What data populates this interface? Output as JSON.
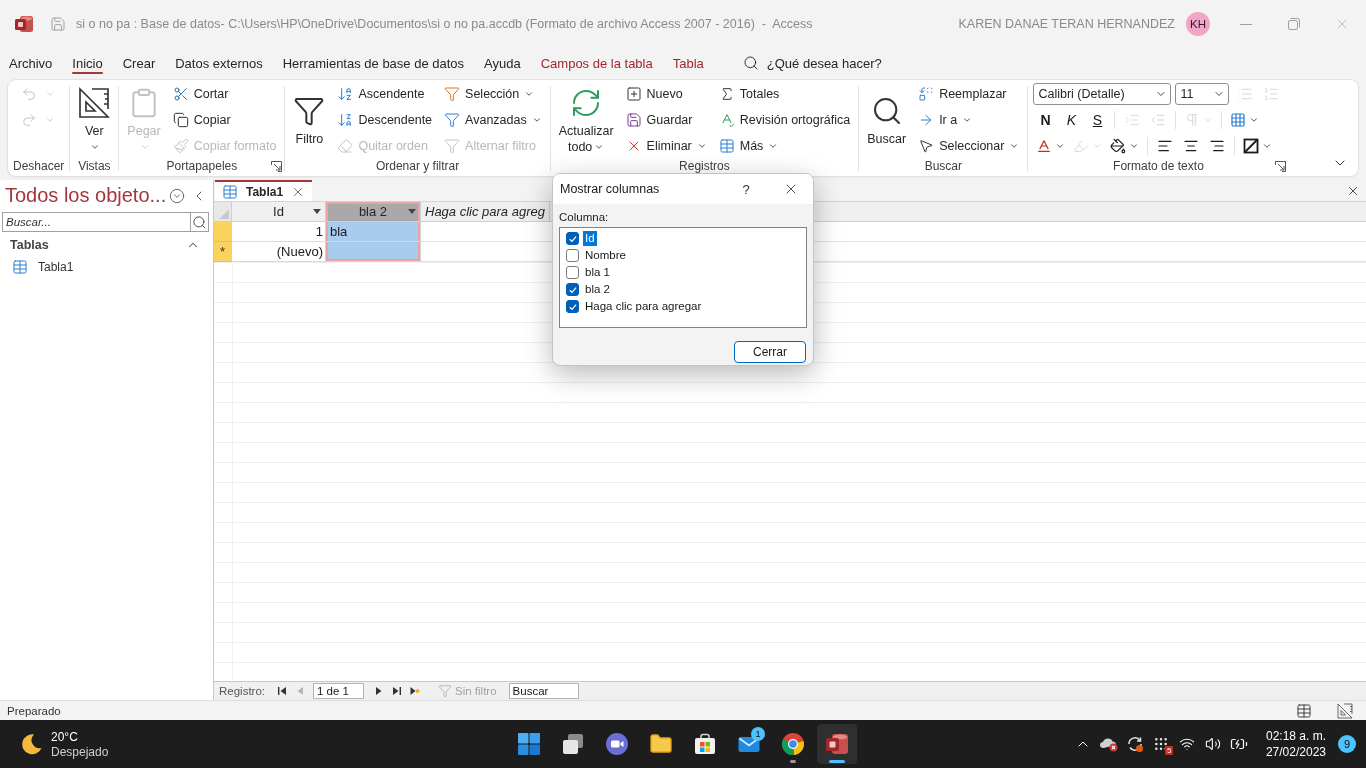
{
  "title_bar": {
    "title": "si o no pa : Base de datos- C:\\Users\\HP\\OneDrive\\Documentos\\si o no pa.accdb (Formato de archivo Access 2007 - 2016)  -  Access",
    "user": "KAREN DANAE TERAN HERNANDEZ",
    "initials": "KH"
  },
  "menu": {
    "tabs": [
      {
        "label": "Archivo",
        "selected": false,
        "contextual": false
      },
      {
        "label": "Inicio",
        "selected": true,
        "contextual": false
      },
      {
        "label": "Crear",
        "selected": false,
        "contextual": false
      },
      {
        "label": "Datos externos",
        "selected": false,
        "contextual": false
      },
      {
        "label": "Herramientas de base de datos",
        "selected": false,
        "contextual": false
      },
      {
        "label": "Ayuda",
        "selected": false,
        "contextual": false
      },
      {
        "label": "Campos de la tabla",
        "selected": false,
        "contextual": true
      },
      {
        "label": "Tabla",
        "selected": false,
        "contextual": true
      }
    ],
    "search": {
      "placeholder": "¿Qué desea hacer?"
    }
  },
  "ribbon": {
    "groups": [
      {
        "kind": "commands",
        "label": "Deshacer",
        "launcher": false,
        "columns": [
          [
            {
              "kind": "icon",
              "disabled": true,
              "menu": true
            },
            {
              "kind": "icon",
              "disabled": true,
              "menu": true
            }
          ]
        ]
      },
      {
        "kind": "commands",
        "label": "Vistas",
        "launcher": false,
        "columns": [
          [
            {
              "kind": "large",
              "lines": [
                "Ver"
              ],
              "disabled": false,
              "menu": true
            }
          ]
        ]
      },
      {
        "kind": "commands",
        "label": "Portapapeles",
        "launcher": true,
        "columns": [
          [
            {
              "kind": "large",
              "lines": [
                "Pegar"
              ],
              "disabled": true,
              "menu": true
            }
          ],
          [
            {
              "kind": "small",
              "label": "Cortar",
              "disabled": false,
              "menu": false
            },
            {
              "kind": "small",
              "label": "Copiar",
              "disabled": false,
              "menu": false
            },
            {
              "kind": "small",
              "label": "Copiar formato",
              "disabled": true,
              "menu": false
            }
          ]
        ]
      },
      {
        "kind": "commands",
        "label": "Ordenar y filtrar",
        "launcher": false,
        "columns": [
          [
            {
              "kind": "large",
              "lines": [
                "Filtro"
              ],
              "disabled": false,
              "menu": false
            }
          ],
          [
            {
              "kind": "small",
              "label": "Ascendente",
              "disabled": false,
              "menu": false
            },
            {
              "kind": "small",
              "label": "Descendente",
              "disabled": false,
              "menu": false
            },
            {
              "kind": "small",
              "label": "Quitar orden",
              "disabled": true,
              "menu": false
            }
          ],
          [
            {
              "kind": "small",
              "label": "Selección",
              "disabled": false,
              "menu": true
            },
            {
              "kind": "small",
              "label": "Avanzadas",
              "disabled": false,
              "menu": true
            },
            {
              "kind": "small",
              "label": "Alternar filtro",
              "disabled": true,
              "menu": false
            }
          ]
        ]
      },
      {
        "kind": "commands",
        "label": "Registros",
        "launcher": false,
        "columns": [
          [
            {
              "kind": "large",
              "lines": [
                "Actualizar",
                "todo"
              ],
              "disabled": false,
              "menu": true
            }
          ],
          [
            {
              "kind": "small",
              "label": "Nuevo",
              "disabled": false,
              "menu": false
            },
            {
              "kind": "small",
              "label": "Guardar",
              "disabled": false,
              "menu": false
            },
            {
              "kind": "small",
              "label": "Eliminar",
              "disabled": false,
              "menu": true
            }
          ],
          [
            {
              "kind": "small",
              "label": "Totales",
              "disabled": false,
              "menu": false
            },
            {
              "kind": "small",
              "label": "Revisión ortográfica",
              "disabled": false,
              "menu": false
            },
            {
              "kind": "small",
              "label": "Más",
              "disabled": false,
              "menu": true
            }
          ]
        ]
      },
      {
        "kind": "commands",
        "label": "Buscar",
        "launcher": false,
        "columns": [
          [
            {
              "kind": "large",
              "lines": [
                "Buscar"
              ],
              "disabled": false,
              "menu": false
            }
          ],
          [
            {
              "kind": "small",
              "label": "Reemplazar",
              "disabled": false,
              "menu": false
            },
            {
              "kind": "small",
              "label": "Ir a",
              "disabled": false,
              "menu": true
            },
            {
              "kind": "small",
              "label": "Seleccionar",
              "disabled": false,
              "menu": true
            }
          ]
        ]
      },
      {
        "kind": "format",
        "label": "Formato de texto",
        "launcher": true,
        "font": {
          "value": "Calibri (Detalle)"
        },
        "size": {
          "value": "11"
        },
        "rows": [
          [
            {
              "kind": "icon",
              "disabled": true,
              "menu": false
            },
            {
              "kind": "icon",
              "disabled": true,
              "menu": false
            }
          ],
          [
            {
              "kind": "text",
              "label": "N",
              "disabled": false,
              "menu": false
            },
            {
              "kind": "text",
              "label": "K",
              "disabled": false,
              "menu": false
            },
            {
              "kind": "text",
              "label": "S",
              "disabled": false,
              "menu": false
            },
            {
              "kind": "separator"
            },
            {
              "kind": "icon",
              "disabled": true,
              "menu": false
            },
            {
              "kind": "icon",
              "disabled": true,
              "menu": false
            },
            {
              "kind": "separator"
            },
            {
              "kind": "icon",
              "disabled": true,
              "menu": true
            },
            {
              "kind": "separator"
            },
            {
              "kind": "icon",
              "disabled": false,
              "menu": true
            }
          ],
          [
            {
              "kind": "icon",
              "disabled": false,
              "menu": true
            },
            {
              "kind": "icon",
              "disabled": true,
              "menu": true
            },
            {
              "kind": "icon",
              "disabled": false,
              "menu": true
            },
            {
              "kind": "separator"
            },
            {
              "kind": "icon",
              "disabled": false,
              "menu": false
            },
            {
              "kind": "icon",
              "disabled": false,
              "menu": false
            },
            {
              "kind": "icon",
              "disabled": false,
              "menu": false
            },
            {
              "kind": "separator"
            },
            {
              "kind": "icon",
              "disabled": false,
              "menu": true
            }
          ]
        ]
      }
    ]
  },
  "nav_pane": {
    "title": "Todos los objeto...",
    "search": {
      "placeholder": "Buscar..."
    },
    "groups": [
      {
        "label": "Tablas",
        "expanded": true,
        "items": [
          {
            "label": "Tabla1",
            "selected": false
          }
        ]
      }
    ]
  },
  "document": {
    "tabs": [
      {
        "label": "Tabla1",
        "selected": true
      }
    ],
    "columns": [
      {
        "kind": "number",
        "label": "Id",
        "selected": false
      },
      {
        "kind": "text",
        "label": "bla 2",
        "selected": true
      },
      {
        "kind": "add",
        "label": "Haga clic para agreg",
        "selected": false
      }
    ],
    "rows": [
      {
        "selected": true,
        "cells": [
          "1",
          "bla"
        ]
      },
      {
        "selected": true,
        "marker": "*",
        "cells": [
          "(Nuevo)"
        ]
      }
    ]
  },
  "record_nav": {
    "label": "Registro:",
    "buttons": [
      {
        "disabled": false
      },
      {
        "disabled": true
      },
      {
        "disabled": false
      },
      {
        "disabled": false
      },
      {
        "disabled": false
      }
    ],
    "position": "1 de 1",
    "filter": {
      "label": "Sin filtro",
      "active": false
    },
    "search": {
      "placeholder": "Buscar"
    }
  },
  "status_bar": {
    "text": "Preparado"
  },
  "dialog": {
    "title": "Mostrar columnas",
    "help": "?",
    "label": "Columna:",
    "items": [
      {
        "label": "Id",
        "checked": true,
        "selected": true
      },
      {
        "label": "Nombre",
        "checked": false,
        "selected": false
      },
      {
        "label": "bla 1",
        "checked": false,
        "selected": false
      },
      {
        "label": "bla 2",
        "checked": true,
        "selected": false
      },
      {
        "label": "Haga clic para agregar",
        "checked": true,
        "selected": false
      }
    ],
    "button": "Cerrar"
  },
  "taskbar": {
    "weather": {
      "temperature": "20°C",
      "condition": "Despejado"
    },
    "apps": [
      {
        "running": false,
        "active": false
      },
      {
        "running": false,
        "active": false
      },
      {
        "running": false,
        "active": false
      },
      {
        "running": false,
        "active": false
      },
      {
        "running": false,
        "active": false
      },
      {
        "running": false,
        "active": false,
        "badge": "1"
      },
      {
        "running": true,
        "active": false
      },
      {
        "running": true,
        "active": true
      }
    ],
    "tray": {
      "app_badge": "5",
      "time": "02:18 a. m.",
      "date": "27/02/2023",
      "notifications": "9"
    }
  }
}
